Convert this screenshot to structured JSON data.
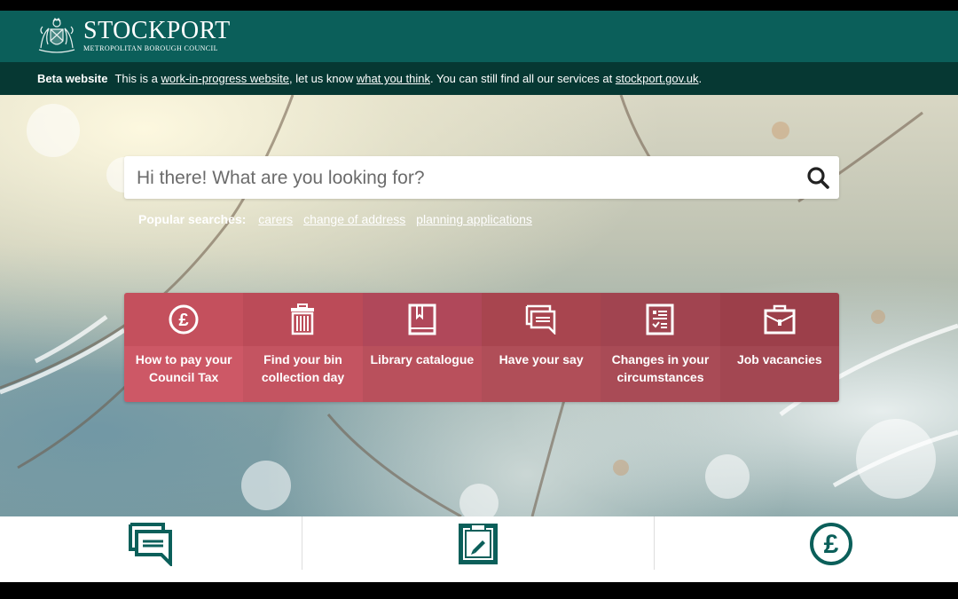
{
  "header": {
    "logo_title": "STOCKPORT",
    "logo_subtitle": "METROPOLITAN BOROUGH COUNCIL",
    "brand_color": "#0b5f5a"
  },
  "beta_banner": {
    "label": "Beta website",
    "text_1": "This is a ",
    "link_1": "work-in-progress website",
    "text_2": ", let us know ",
    "link_2": "what you think",
    "text_3": ". You can still find all our services at ",
    "link_3": "stockport.gov.uk",
    "text_4": "."
  },
  "search": {
    "placeholder": "Hi there! What are you looking for?",
    "value": "",
    "button_icon": "search-icon"
  },
  "popular_searches": {
    "label": "Popular searches:",
    "links": [
      "carers",
      "change of address",
      "planning applications"
    ]
  },
  "tiles": [
    {
      "icon": "pound-circle-icon",
      "label": "How to pay your Council Tax"
    },
    {
      "icon": "bin-icon",
      "label": "Find your bin collection day"
    },
    {
      "icon": "book-icon",
      "label": "Library catalogue"
    },
    {
      "icon": "chat-bubbles-icon",
      "label": "Have your say"
    },
    {
      "icon": "checklist-icon",
      "label": "Changes in your circumstances"
    },
    {
      "icon": "briefcase-icon",
      "label": "Job vacancies"
    }
  ],
  "bottom_sections": [
    {
      "icon": "chat-bubbles-icon"
    },
    {
      "icon": "clipboard-edit-icon"
    },
    {
      "icon": "pound-circle-icon"
    }
  ],
  "colors": {
    "tile_accent": "#c4505d",
    "icon_green": "#0b5f5a"
  }
}
